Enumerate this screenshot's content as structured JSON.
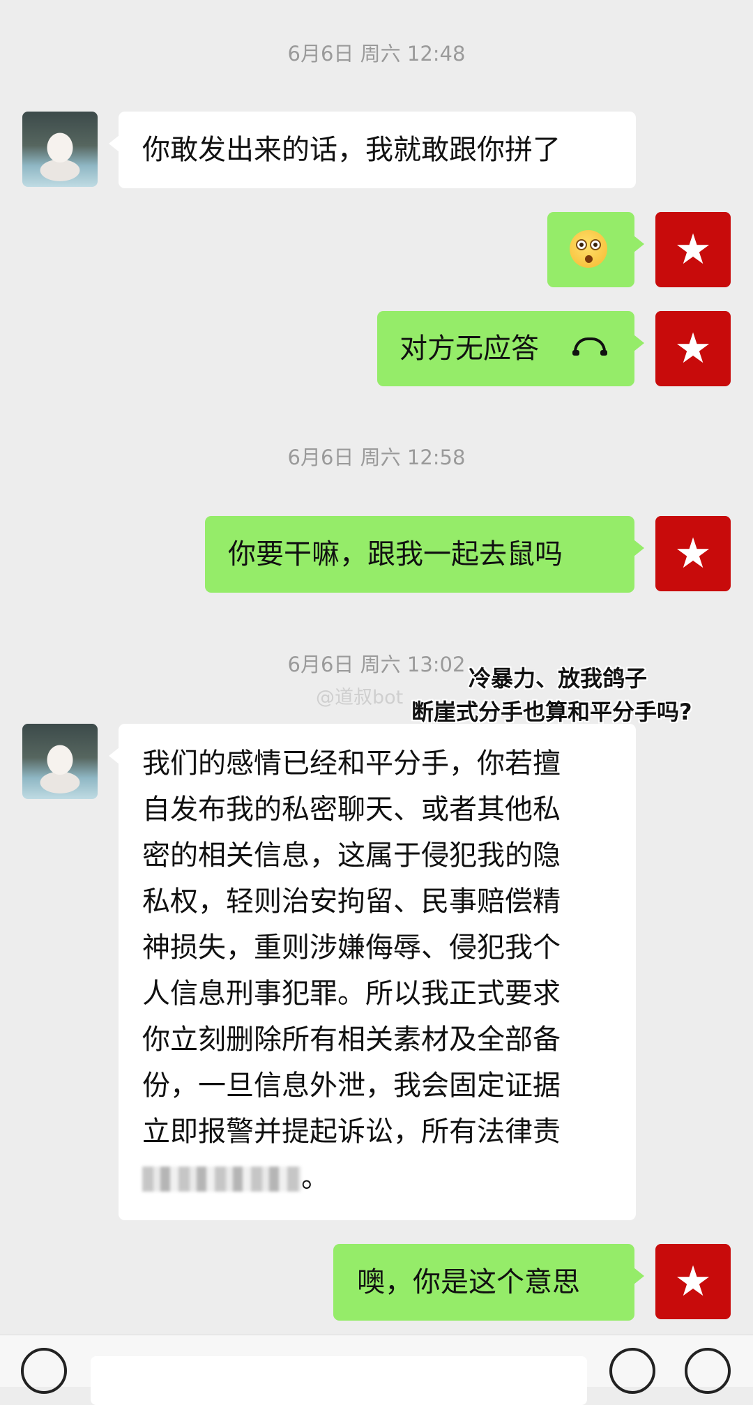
{
  "chat": {
    "timestamps": [
      "6月6日 周六 12:48",
      "6月6日 周六 12:58",
      "6月6日 周六 13:02"
    ],
    "messages": [
      {
        "sender": "other",
        "text": "你敢发出来的话，我就敢跟你拼了"
      },
      {
        "sender": "me",
        "emoji": "flushed-face-emoji"
      },
      {
        "sender": "me",
        "text": "对方无应答",
        "icon": "hang-up-phone-icon"
      },
      {
        "sender": "me",
        "text": "你要干嘛，跟我一起去鼠吗"
      },
      {
        "sender": "other",
        "lines": [
          "我们的感情已经和平分手，你若擅",
          "自发布我的私密聊天、或者其他私",
          "密的相关信息，这属于侵犯我的隐",
          "私权，轻则治安拘留、民事赔偿精",
          "神损失，重则涉嫌侮辱、侵犯我个",
          "人信息刑事犯罪。所以我正式要求",
          "你立刻删除所有相关素材及全部备",
          "份，一旦信息外泄，我会固定证据",
          "立即报警并提起诉讼，所有法律责"
        ],
        "last_line_end": "。"
      },
      {
        "sender": "me",
        "text": "噢，你是这个意思"
      }
    ]
  },
  "avatars": {
    "other": "white-cat-photo",
    "me": "red-star-hammer-sickle-icon",
    "me_glyph": "★"
  },
  "overlay": {
    "line1": "冷暴力、放我鸽子",
    "line2": "断崖式分手也算和平分手吗?",
    "watermark": "@道叔bot"
  },
  "colors": {
    "background": "#ededed",
    "my_bubble": "#95ec69",
    "their_bubble": "#ffffff",
    "my_avatar": "#c80b0b",
    "timestamp": "#9a9a9a"
  }
}
